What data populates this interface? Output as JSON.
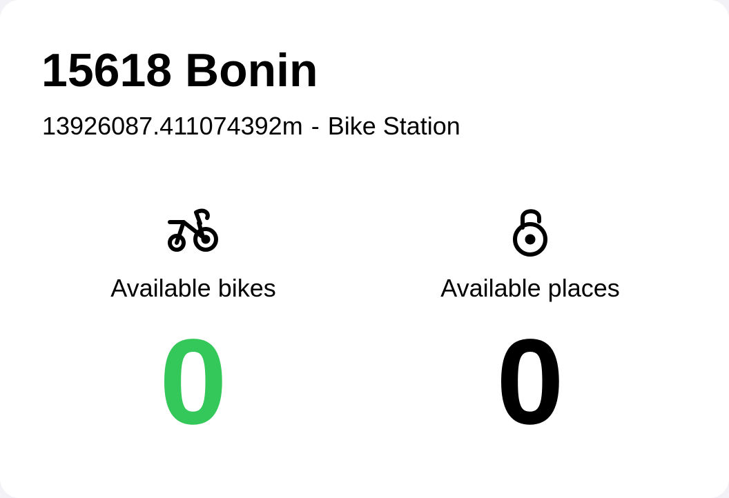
{
  "station": {
    "name": "15618 Bonin",
    "distance": "13926087.411074392m",
    "separator": "-",
    "type": "Bike Station"
  },
  "stats": {
    "bikes": {
      "icon": "bicycle-icon",
      "label": "Available bikes",
      "value": "0",
      "color": "#34c759"
    },
    "places": {
      "icon": "open-lock-icon",
      "label": "Available places",
      "value": "0",
      "color": "#000000"
    }
  }
}
